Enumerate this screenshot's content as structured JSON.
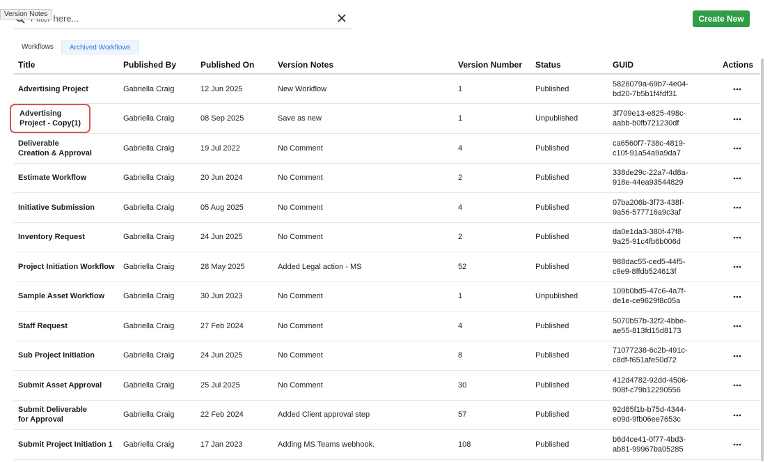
{
  "tooltip": "Version Notes",
  "filter": {
    "placeholder": "Filter here..."
  },
  "create_button": "Create New",
  "tabs": [
    {
      "label": "Workflows",
      "active": false
    },
    {
      "label": "Archived Workflows",
      "active": true
    }
  ],
  "columns": {
    "title": "Title",
    "published_by": "Published By",
    "published_on": "Published On",
    "version_notes": "Version Notes",
    "version_number": "Version Number",
    "status": "Status",
    "guid": "GUID",
    "actions": "Actions"
  },
  "rows": [
    {
      "title": "Advertising Project",
      "published_by": "Gabriella Craig",
      "published_on": "12 Jun 2025",
      "version_notes": "New Workflow",
      "version_number": "1",
      "status": "Published",
      "guid": "5828079a-69b7-4e04-\nbd20-7b5b1f4fdf31",
      "highlighted": false
    },
    {
      "title": "Advertising\nProject - Copy(1)",
      "published_by": "Gabriella Craig",
      "published_on": "08 Sep 2025",
      "version_notes": "Save as new",
      "version_number": "1",
      "status": "Unpublished",
      "guid": "3f709e13-e825-498c-\naabb-b0fb721230df",
      "highlighted": true
    },
    {
      "title": "Deliverable\nCreation & Approval",
      "published_by": "Gabriella Craig",
      "published_on": "19 Jul 2022",
      "version_notes": "No Comment",
      "version_number": "4",
      "status": "Published",
      "guid": "ca6560f7-738c-4819-\nc10f-91a54a9a9da7",
      "highlighted": false
    },
    {
      "title": "Estimate Workflow",
      "published_by": "Gabriella Craig",
      "published_on": "20 Jun 2024",
      "version_notes": "No Comment",
      "version_number": "2",
      "status": "Published",
      "guid": "338de29c-22a7-4d8a-\n918e-44ea93544829",
      "highlighted": false
    },
    {
      "title": "Initiative Submission",
      "published_by": "Gabriella Craig",
      "published_on": "05 Aug 2025",
      "version_notes": "No Comment",
      "version_number": "4",
      "status": "Published",
      "guid": "07ba206b-3f73-438f-\n9a56-577716a9c3af",
      "highlighted": false
    },
    {
      "title": "Inventory Request",
      "published_by": "Gabriella Craig",
      "published_on": "24 Jun 2025",
      "version_notes": "No Comment",
      "version_number": "2",
      "status": "Published",
      "guid": "da0e1da3-380f-47f8-\n9a25-91c4fb6b006d",
      "highlighted": false
    },
    {
      "title": "Project Initiation Workflow",
      "published_by": "Gabriella Craig",
      "published_on": "28 May 2025",
      "version_notes": "Added Legal action - MS",
      "version_number": "52",
      "status": "Published",
      "guid": "988dac55-ced5-44f5-\nc9e9-8ffdb524613f",
      "highlighted": false
    },
    {
      "title": "Sample Asset Workflow",
      "published_by": "Gabriella Craig",
      "published_on": "30 Jun 2023",
      "version_notes": "No Comment",
      "version_number": "1",
      "status": "Unpublished",
      "guid": "109b0bd5-47c6-4a7f-\nde1e-ce9629f8c05a",
      "highlighted": false
    },
    {
      "title": "Staff Request",
      "published_by": "Gabriella Craig",
      "published_on": "27 Feb 2024",
      "version_notes": "No Comment",
      "version_number": "4",
      "status": "Published",
      "guid": "5070b57b-32f2-4bbe-\nae55-813fd15d8173",
      "highlighted": false
    },
    {
      "title": "Sub Project Initiation",
      "published_by": "Gabriella Craig",
      "published_on": "24 Jun 2025",
      "version_notes": "No Comment",
      "version_number": "8",
      "status": "Published",
      "guid": "71077238-6c2b-491c-\nc8df-f651afe50d72",
      "highlighted": false
    },
    {
      "title": "Submit Asset Approval",
      "published_by": "Gabriella Craig",
      "published_on": "25 Jul 2025",
      "version_notes": "No Comment",
      "version_number": "30",
      "status": "Published",
      "guid": "412d4782-92dd-4506-\n908f-c79b12290556",
      "highlighted": false
    },
    {
      "title": "Submit Deliverable\nfor Approval",
      "published_by": "Gabriella Craig",
      "published_on": "22 Feb 2024",
      "version_notes": "Added Client approval step",
      "version_number": "57",
      "status": "Published",
      "guid": "92d85f1b-b75d-4344-\ne09d-9fb06ee7653c",
      "highlighted": false
    },
    {
      "title": "Submit Project Initiation 1",
      "published_by": "Gabriella Craig",
      "published_on": "17 Jan 2023",
      "version_notes": "Adding MS Teams webhook.",
      "version_number": "108",
      "status": "Published",
      "guid": "b6d4ce41-0f77-4bd3-\nab81-99967ba05285",
      "highlighted": false
    }
  ],
  "icons": {
    "search": "search-icon",
    "clear": "close-icon",
    "more": "more-horizontal-icon"
  },
  "colors": {
    "accent": "#2a7de1",
    "create": "#2f9e44",
    "highlight": "#d9534f"
  }
}
